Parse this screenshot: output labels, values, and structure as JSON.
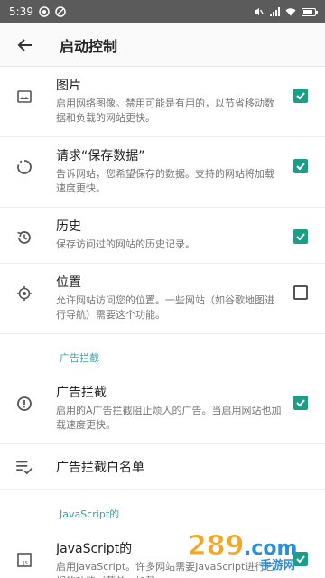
{
  "status_bar": {
    "time": "5:39"
  },
  "app_bar": {
    "title": "启动控制"
  },
  "items": [
    {
      "title": "图片",
      "desc": "启用网络图像。禁用可能是有用的，以节省移动数据和负载的网站更快。",
      "checked": true
    },
    {
      "title": "请求“保存数据”",
      "desc": "告诉网站，您希望保存的数据。支持的网站将加载速度更快。",
      "checked": true
    },
    {
      "title": "历史",
      "desc": "保存访问过的网站的历史记录。",
      "checked": true
    },
    {
      "title": "位置",
      "desc": "允许网站访问您的位置。一些网站（如谷歌地图进行导航）需要这个功能。",
      "checked": false
    }
  ],
  "sections": [
    {
      "header": "广告拦截",
      "items": [
        {
          "title": "广告拦截",
          "desc": "启用的A广告拦截阻止烦人的广告。当启用网站也加载速度更快。",
          "checked": true
        },
        {
          "title": "广告拦截白名单"
        }
      ]
    },
    {
      "header": "JavaScript的",
      "items": [
        {
          "title": "JavaScript的",
          "desc": "启用JavaScript。许多网站需要JavaScript进行它们的功能（菜单，加载",
          "checked": true
        }
      ]
    }
  ],
  "watermark": {
    "text": "289.com",
    "subtext": "手游网"
  },
  "colors": {
    "accent": "#1a9e86",
    "section": "#3aa1a0",
    "status_bar": "#5b5b5b"
  }
}
